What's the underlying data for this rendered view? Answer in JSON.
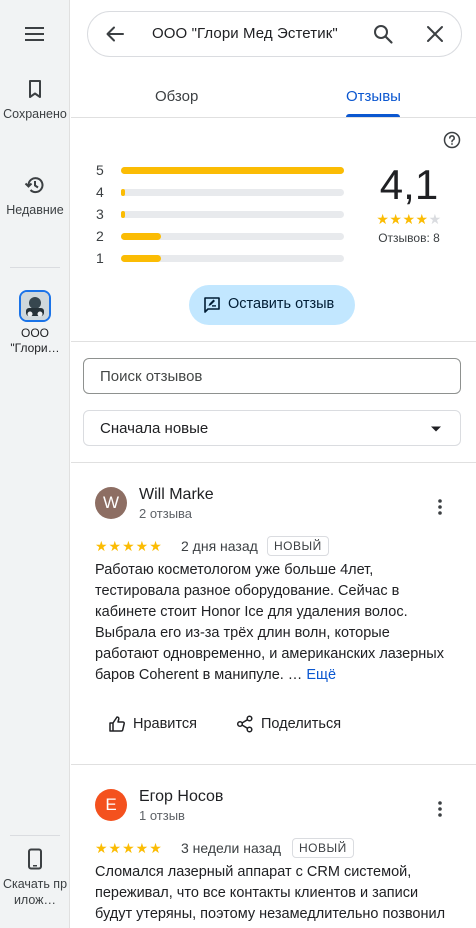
{
  "rail": {
    "saved_label": "Сохранено",
    "recent_label": "Недавние",
    "place_label_1": "ООО",
    "place_label_2": "\"Глори…",
    "download_label": "Скачать прилож…"
  },
  "search": {
    "query": "ООО \"Глори Мед Эстетик\""
  },
  "tabs": {
    "overview": "Обзор",
    "reviews": "Отзывы"
  },
  "summary": {
    "rating": "4,1",
    "stars_filled": 4,
    "count_label": "Отзывов: 8",
    "distribution": [
      {
        "stars": "5",
        "fraction": 1.0
      },
      {
        "stars": "4",
        "fraction": 0.02
      },
      {
        "stars": "3",
        "fraction": 0.02
      },
      {
        "stars": "2",
        "fraction": 0.18
      },
      {
        "stars": "1",
        "fraction": 0.18
      }
    ],
    "write_review": "Оставить отзыв"
  },
  "controls": {
    "search_placeholder": "Поиск отзывов",
    "sort_value": "Сначала новые"
  },
  "reviews": [
    {
      "initial": "W",
      "avatar_color": "#8d6e63",
      "name": "Will Marke",
      "meta": "2 отзыва",
      "stars": "★★★★★",
      "date": "2 дня назад",
      "badge": "НОВЫЙ",
      "text": "Работаю косметологом уже больше 4лет, тестировала разное оборудование. Сейчас в кабинете стоит Honor Ice для удаления волос. Выбрала его из-за трёх длин волн, которые работают одновременно, и американских лазерных баров Coherent в манипуле. …",
      "more": "Ещё",
      "like": "Нравится",
      "share": "Поделиться"
    },
    {
      "initial": "Е",
      "avatar_color": "#f4511e",
      "name": "Егор Носов",
      "meta": "1 отзыв",
      "stars": "★★★★★",
      "date": "3 недели назад",
      "badge": "НОВЫЙ",
      "text": "Сломался лазерный аппарат с CRM системой, переживал, что все контакты клиентов и записи будут утеряны, поэтому незамедлительно позвонил"
    }
  ]
}
